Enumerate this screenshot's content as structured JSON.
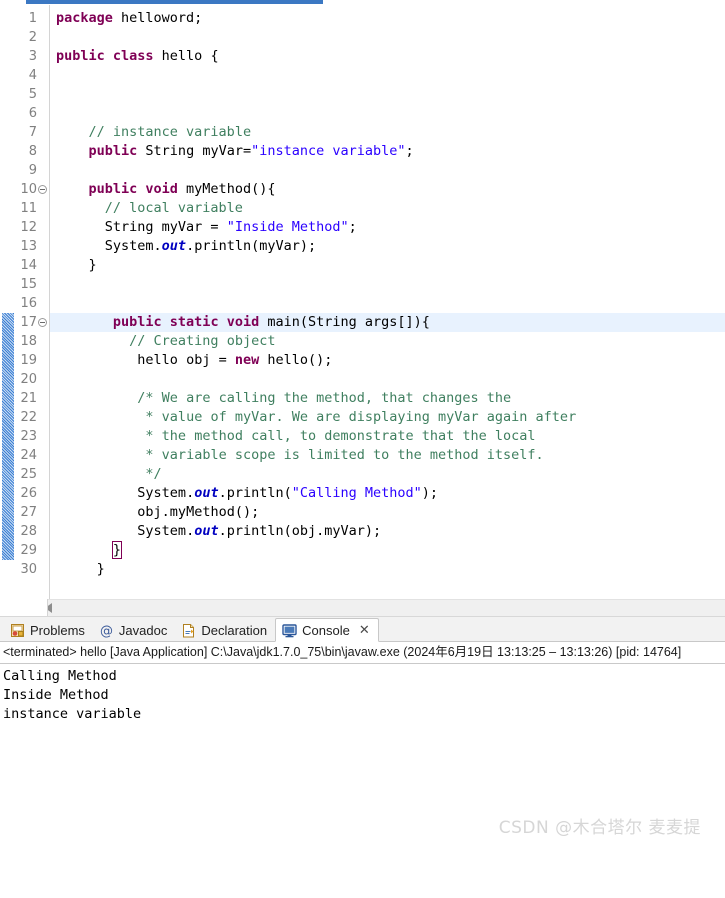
{
  "editor": {
    "active_tab_indicator": true,
    "highlighted_line": 17,
    "change_bar_from_line": 17,
    "change_bar_to_line": 29,
    "lines": [
      {
        "n": 1,
        "indent": 0,
        "fold": false,
        "tokens": [
          {
            "t": "kw",
            "s": "package"
          },
          {
            "t": "plain",
            "s": " helloword;"
          }
        ]
      },
      {
        "n": 2,
        "indent": 0,
        "fold": false,
        "tokens": []
      },
      {
        "n": 3,
        "indent": 0,
        "fold": false,
        "tokens": [
          {
            "t": "kw",
            "s": "public class"
          },
          {
            "t": "plain",
            "s": " hello {"
          }
        ]
      },
      {
        "n": 4,
        "indent": 0,
        "fold": false,
        "tokens": []
      },
      {
        "n": 5,
        "indent": 0,
        "fold": false,
        "tokens": []
      },
      {
        "n": 6,
        "indent": 0,
        "fold": false,
        "tokens": []
      },
      {
        "n": 7,
        "indent": 4,
        "fold": false,
        "tokens": [
          {
            "t": "cmt",
            "s": "// instance variable"
          }
        ]
      },
      {
        "n": 8,
        "indent": 4,
        "fold": false,
        "tokens": [
          {
            "t": "kw",
            "s": "public"
          },
          {
            "t": "plain",
            "s": " String myVar="
          },
          {
            "t": "str",
            "s": "\"instance variable\""
          },
          {
            "t": "plain",
            "s": ";"
          }
        ]
      },
      {
        "n": 9,
        "indent": 0,
        "fold": false,
        "tokens": []
      },
      {
        "n": 10,
        "indent": 4,
        "fold": true,
        "tokens": [
          {
            "t": "kw",
            "s": "public void"
          },
          {
            "t": "plain",
            "s": " myMethod(){"
          }
        ]
      },
      {
        "n": 11,
        "indent": 6,
        "fold": false,
        "tokens": [
          {
            "t": "cmt",
            "s": "// local variable"
          }
        ]
      },
      {
        "n": 12,
        "indent": 6,
        "fold": false,
        "tokens": [
          {
            "t": "plain",
            "s": "String myVar = "
          },
          {
            "t": "str",
            "s": "\"Inside Method\""
          },
          {
            "t": "plain",
            "s": ";"
          }
        ]
      },
      {
        "n": 13,
        "indent": 6,
        "fold": false,
        "tokens": [
          {
            "t": "plain",
            "s": "System."
          },
          {
            "t": "fld",
            "s": "out"
          },
          {
            "t": "plain",
            "s": ".println(myVar);"
          }
        ]
      },
      {
        "n": 14,
        "indent": 4,
        "fold": false,
        "tokens": [
          {
            "t": "plain",
            "s": "}"
          }
        ]
      },
      {
        "n": 15,
        "indent": 0,
        "fold": false,
        "tokens": []
      },
      {
        "n": 16,
        "indent": 0,
        "fold": false,
        "tokens": []
      },
      {
        "n": 17,
        "indent": 7,
        "fold": true,
        "tokens": [
          {
            "t": "kw",
            "s": "public static void"
          },
          {
            "t": "plain",
            "s": " main(String args[]){"
          }
        ]
      },
      {
        "n": 18,
        "indent": 9,
        "fold": false,
        "tokens": [
          {
            "t": "cmt",
            "s": "// Creating object"
          }
        ]
      },
      {
        "n": 19,
        "indent": 10,
        "fold": false,
        "tokens": [
          {
            "t": "plain",
            "s": "hello obj = "
          },
          {
            "t": "kw",
            "s": "new"
          },
          {
            "t": "plain",
            "s": " hello();"
          }
        ]
      },
      {
        "n": 20,
        "indent": 0,
        "fold": false,
        "tokens": []
      },
      {
        "n": 21,
        "indent": 10,
        "fold": false,
        "tokens": [
          {
            "t": "cmt",
            "s": "/* We are calling the method, that changes the"
          }
        ]
      },
      {
        "n": 22,
        "indent": 10,
        "fold": false,
        "tokens": [
          {
            "t": "cmt",
            "s": " * value of myVar. We are displaying myVar again after"
          }
        ]
      },
      {
        "n": 23,
        "indent": 10,
        "fold": false,
        "tokens": [
          {
            "t": "cmt",
            "s": " * the method call, to demonstrate that the local"
          }
        ]
      },
      {
        "n": 24,
        "indent": 10,
        "fold": false,
        "tokens": [
          {
            "t": "cmt",
            "s": " * variable scope is limited to the method itself."
          }
        ]
      },
      {
        "n": 25,
        "indent": 10,
        "fold": false,
        "tokens": [
          {
            "t": "cmt",
            "s": " */"
          }
        ]
      },
      {
        "n": 26,
        "indent": 10,
        "fold": false,
        "tokens": [
          {
            "t": "plain",
            "s": "System."
          },
          {
            "t": "fld",
            "s": "out"
          },
          {
            "t": "plain",
            "s": ".println("
          },
          {
            "t": "str",
            "s": "\"Calling Method\""
          },
          {
            "t": "plain",
            "s": ");"
          }
        ]
      },
      {
        "n": 27,
        "indent": 10,
        "fold": false,
        "tokens": [
          {
            "t": "plain",
            "s": "obj.myMethod();"
          }
        ]
      },
      {
        "n": 28,
        "indent": 10,
        "fold": false,
        "tokens": [
          {
            "t": "plain",
            "s": "System."
          },
          {
            "t": "fld",
            "s": "out"
          },
          {
            "t": "plain",
            "s": ".println(obj.myVar);"
          }
        ]
      },
      {
        "n": 29,
        "indent": 7,
        "fold": false,
        "boxed": true,
        "tokens": [
          {
            "t": "plain",
            "s": "}"
          }
        ]
      },
      {
        "n": 30,
        "indent": 5,
        "fold": false,
        "tokens": [
          {
            "t": "plain",
            "s": "}"
          }
        ]
      }
    ],
    "hscroll": {
      "left_arrow": "◀"
    }
  },
  "bottom_panel": {
    "tabs": [
      {
        "label": "Problems",
        "icon": "problems-icon",
        "active": false
      },
      {
        "label": "Javadoc",
        "icon": "javadoc-icon",
        "active": false
      },
      {
        "label": "Declaration",
        "icon": "declaration-icon",
        "active": false
      },
      {
        "label": "Console",
        "icon": "console-icon",
        "active": true,
        "close": "✕"
      }
    ],
    "terminated_line": "<terminated> hello [Java Application] C:\\Java\\jdk1.7.0_75\\bin\\javaw.exe  (2024年6月19日 13:13:25 – 13:13:26) [pid: 14764]",
    "output": "Calling Method\nInside Method\ninstance variable"
  },
  "watermark": {
    "text": "CSDN @木合塔尔 麦麦提"
  },
  "colors": {
    "keyword": "#7f0055",
    "string": "#2a00ff",
    "comment": "#3f7f5f",
    "field": "#0000c0",
    "highlight_line": "#e8f2fe",
    "tab_accent": "#3b78c3",
    "change_bar": "#3b7fd4"
  }
}
